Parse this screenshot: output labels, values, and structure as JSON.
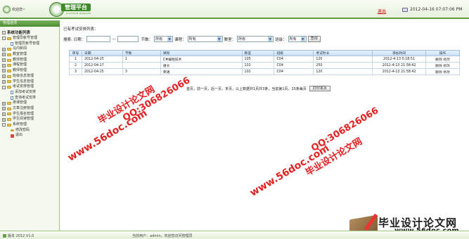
{
  "header": {
    "welcome": "欢迎您~",
    "logo_title": "管理平台",
    "logo_subtitle": "PLATFORM MANAGER",
    "logout": "退出",
    "datetime": "2012-04-16 07:07:06 PM"
  },
  "sidebar": {
    "header": "管理选项",
    "root": "系统功能列表",
    "items": [
      {
        "label": "管理员帐号管理",
        "level": 0,
        "toggle": "-"
      },
      {
        "label": "管理员帐号管理",
        "level": 1
      },
      {
        "label": "马内新闻",
        "level": 0,
        "toggle": "+"
      },
      {
        "label": "教室管理",
        "level": 0,
        "toggle": "+"
      },
      {
        "label": "教师管理",
        "level": 0,
        "toggle": "+"
      },
      {
        "label": "课程管理",
        "level": 0,
        "toggle": "+"
      },
      {
        "label": "教师管理",
        "level": 0,
        "toggle": "+"
      },
      {
        "label": "班级信息管理",
        "level": 0,
        "toggle": "+"
      },
      {
        "label": "学生信息管理",
        "level": 0,
        "toggle": "+"
      },
      {
        "label": "考试安排管理",
        "level": 0,
        "toggle": "-"
      },
      {
        "label": "添加考试安排",
        "level": 1
      },
      {
        "label": "查询考试安排",
        "level": 1
      },
      {
        "label": "排课管理",
        "level": 0,
        "toggle": "+"
      },
      {
        "label": "文章注册管理",
        "level": 0,
        "toggle": "+"
      },
      {
        "label": "学生报名管理",
        "level": 0,
        "toggle": "+"
      },
      {
        "label": "学生阅读管理",
        "level": 0,
        "toggle": "+"
      },
      {
        "label": "系统管理",
        "level": 0,
        "toggle": "-"
      },
      {
        "label": "修改密码",
        "level": 1,
        "icon": "key"
      },
      {
        "label": "退出",
        "level": 1,
        "icon": "exit"
      }
    ]
  },
  "main": {
    "title": "已有考试安排列表：",
    "filter": {
      "search_label": "搜索: 日期：",
      "dash": "—",
      "period_label": "节数：",
      "period_value": "所有",
      "course_label": "课程：",
      "course_value": "所有",
      "room_label": "教室：",
      "room_value": "所有",
      "class_label": "班级：",
      "class_value": "所有",
      "query_button": "查询"
    },
    "table": {
      "headers": [
        "序号",
        "日期",
        "节数",
        "课程",
        "教室",
        "班级",
        "考试时长",
        "添加时间",
        "操作"
      ],
      "rows": [
        {
          "no": "1",
          "date": "2012-04-25",
          "period": "1",
          "course": "C#编程技术",
          "room": "105",
          "class": "C04",
          "duration": "120",
          "added": "2012-4-13 0:18:51",
          "delete": "删除",
          "edit": "修改"
        },
        {
          "no": "2",
          "date": "2012-04-17",
          "period": "",
          "course": "语文",
          "room": "101",
          "class": "C04",
          "duration": "250",
          "added": "2012-4-13 21:58:42",
          "delete": "删除",
          "edit": "修改"
        },
        {
          "no": "3",
          "date": "2012-04-25",
          "period": "3",
          "course": "英语",
          "room": "102",
          "class": "C04",
          "duration": "120",
          "added": "2012-4-13 21:58:42",
          "delete": "删除",
          "edit": "修改"
        }
      ]
    },
    "pager": {
      "text": "首页，前一页，后一页，末页，以上数据共1页共3条，当前第1页，15条每页",
      "print_button": "打印本页"
    }
  },
  "watermarks": {
    "text1": "毕业设计论文网",
    "qq": "QQ:306826066",
    "url": "www.56doc.com"
  },
  "footer": {
    "version": "版本 2012 V1.0",
    "current_user": "当前用户：admin，欢迎您访问管理员"
  },
  "brand": {
    "name": "毕业设计论文网",
    "url": "www.56doc.com"
  }
}
